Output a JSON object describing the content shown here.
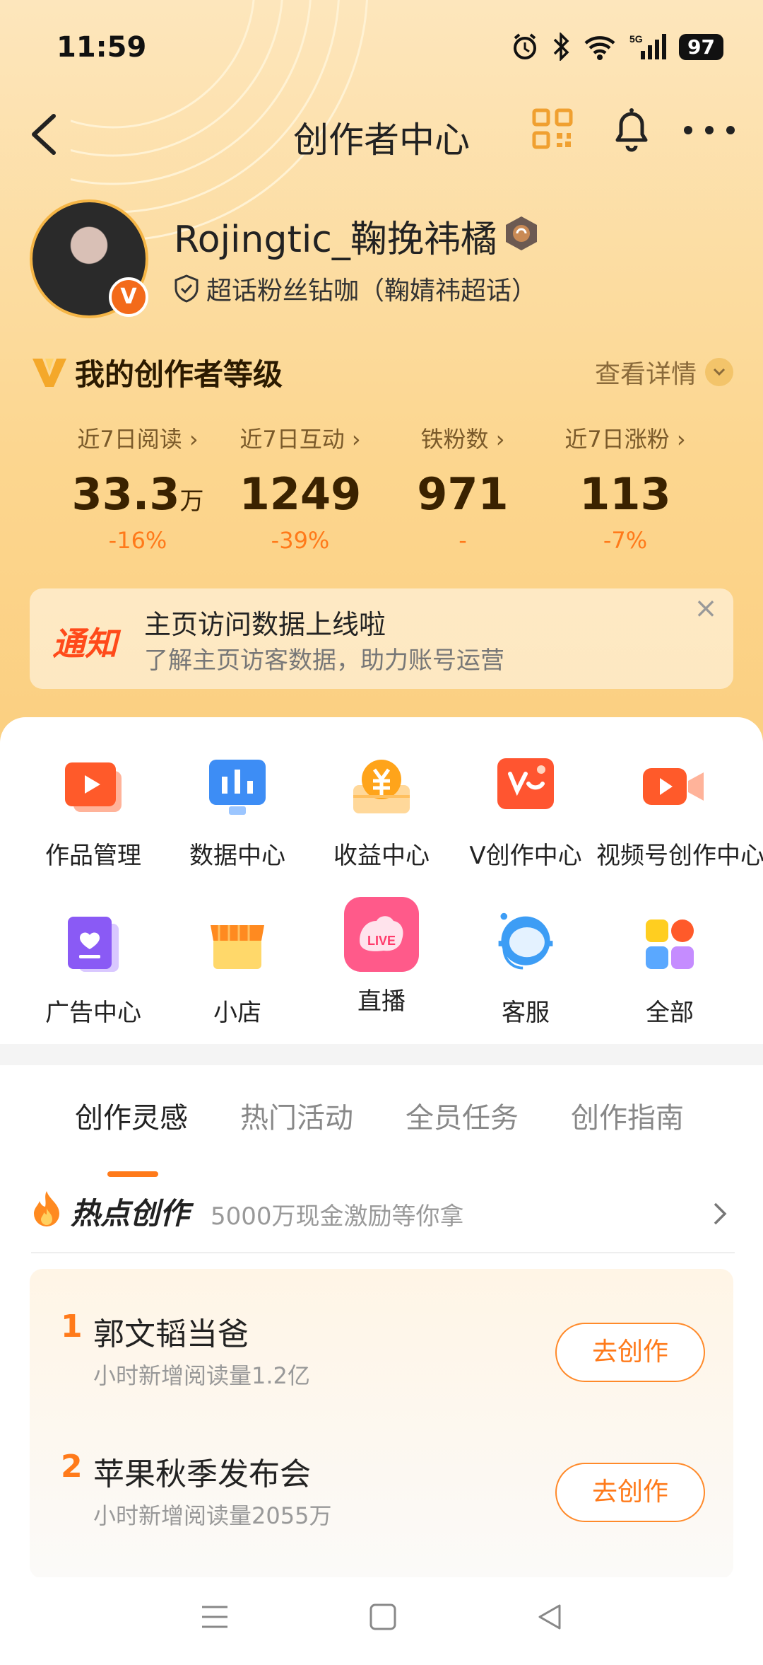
{
  "status_bar": {
    "time": "11:59",
    "battery": "97",
    "network": "5G"
  },
  "nav": {
    "title": "创作者中心"
  },
  "profile": {
    "username": "Rojingtic_鞠挽祎橘",
    "fan_title": "超话粉丝钻咖（鞠婧祎超话）",
    "verified_badge": "V"
  },
  "creator_level": {
    "title": "我的创作者等级",
    "detail_link": "查看详情"
  },
  "stats": [
    {
      "label": "近7日阅读",
      "value": "33.3",
      "unit": "万",
      "change": "-16%"
    },
    {
      "label": "近7日互动",
      "value": "1249",
      "unit": "",
      "change": "-39%"
    },
    {
      "label": "铁粉数",
      "value": "971",
      "unit": "",
      "change": "-"
    },
    {
      "label": "近7日涨粉",
      "value": "113",
      "unit": "",
      "change": "-7%"
    }
  ],
  "notice": {
    "tag": "通知",
    "title": "主页访问数据上线啦",
    "subtitle": "了解主页访客数据，助力账号运营",
    "close": "×"
  },
  "tools": [
    {
      "label": "作品管理",
      "icon": "works-icon"
    },
    {
      "label": "数据中心",
      "icon": "data-chart-icon"
    },
    {
      "label": "收益中心",
      "icon": "income-yen-icon"
    },
    {
      "label": "V创作中心",
      "icon": "v-create-icon"
    },
    {
      "label": "视频号创作中心",
      "icon": "video-camera-icon"
    },
    {
      "label": "广告中心",
      "icon": "ad-heart-icon"
    },
    {
      "label": "小店",
      "icon": "shop-icon"
    },
    {
      "label": "直播",
      "icon": "live-icon",
      "icon_text": "LIVE"
    },
    {
      "label": "客服",
      "icon": "customer-service-icon"
    },
    {
      "label": "全部",
      "icon": "all-apps-icon"
    }
  ],
  "tabs": [
    {
      "label": "创作灵感",
      "active": true
    },
    {
      "label": "热门活动",
      "active": false
    },
    {
      "label": "全员任务",
      "active": false
    },
    {
      "label": "创作指南",
      "active": false
    }
  ],
  "hot": {
    "title": "热点创作",
    "subtitle": "5000万现金激励等你拿",
    "items": [
      {
        "rank": "1",
        "name": "郭文韬当爸",
        "meta": "小时新增阅读量1.2亿",
        "button": "去创作"
      },
      {
        "rank": "2",
        "name": "苹果秋季发布会",
        "meta": "小时新增阅读量2055万",
        "button": "去创作"
      }
    ]
  },
  "colors": {
    "accent": "#ff7a1a",
    "header_gold": "#fcd68f",
    "notice_red": "#ff4a1a"
  }
}
